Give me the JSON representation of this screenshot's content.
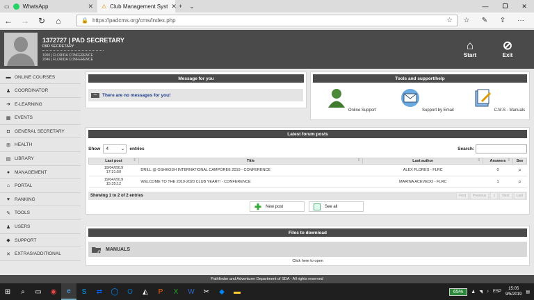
{
  "browser": {
    "tabs": [
      {
        "label": "WhatsApp"
      },
      {
        "label": "Club Management Syst"
      }
    ],
    "url": "https://padcms.org/cms/index.php"
  },
  "user": {
    "name": "1372727 | PAD SECRETARY",
    "role": "PAD SECRETARY",
    "conf1": "1000 | FLORIDA CONFERENCE",
    "conf2": "2046 | FLORIDA CONFERENCE"
  },
  "header_buttons": {
    "start": "Start",
    "exit": "Exit"
  },
  "sidebar": {
    "items": [
      {
        "label": "ONLINE COURSES",
        "icon": "monitor-icon"
      },
      {
        "label": "COORDINATOR",
        "icon": "user-tie-icon"
      },
      {
        "label": "E-LEARNING",
        "icon": "arrow-icon"
      },
      {
        "label": "EVENTS",
        "icon": "calendar-icon"
      },
      {
        "label": "GENERAL SECRETARY",
        "icon": "secretary-icon"
      },
      {
        "label": "HEALTH",
        "icon": "health-icon"
      },
      {
        "label": "LIBRARY",
        "icon": "library-icon"
      },
      {
        "label": "MANAGEMENT",
        "icon": "globe-icon"
      },
      {
        "label": "PORTAL",
        "icon": "home-icon"
      },
      {
        "label": "RANKING",
        "icon": "trophy-icon"
      },
      {
        "label": "TOOLS",
        "icon": "wrench-icon"
      },
      {
        "label": "USERS",
        "icon": "users-icon"
      },
      {
        "label": "SUPPORT",
        "icon": "handshake-icon"
      },
      {
        "label": "EXTRAS/ADDITIONAL",
        "icon": "extras-icon"
      }
    ]
  },
  "message_panel": {
    "title": "Message for you",
    "text": "There are no messages for you!"
  },
  "tools_panel": {
    "title": "Tools and support/help",
    "items": [
      {
        "label": "Online Support"
      },
      {
        "label": "Support by Email"
      },
      {
        "label": "C.M.S - Manuals"
      }
    ]
  },
  "forum": {
    "title": "Latest forum posts",
    "show_label": "Show",
    "entries_value": "4",
    "entries_label": "entries",
    "search_label": "Search:",
    "columns": [
      "Last post",
      "Title",
      "Last author",
      "Answers",
      "See"
    ],
    "rows": [
      {
        "date": "19/04/2019",
        "time": "17:31:50",
        "title": "DRILL @ OSHKOSH INTERNATIONAL CAMPOREE 2019 - CONFERENCE",
        "author": "ALEX FLORES - FLRC",
        "answers": "0"
      },
      {
        "date": "19/04/2019",
        "time": "15:35:12",
        "title": "WELCOME TO THE 2019-2020 CLUB YEAR!!! - CONFERENCE",
        "author": "MARINA ACEVEDO - FLRC",
        "answers": "1"
      }
    ],
    "info": "Showing 1 to 2 of 2 entries",
    "pager": [
      "First",
      "Previous",
      "1",
      "Next",
      "Last"
    ],
    "new_post": "New post",
    "see_all": "See all"
  },
  "files": {
    "title": "Files to download",
    "manuals": "MANUALS",
    "click": "Click here to open"
  },
  "footer": "Pathfinder and Adventurer Department of SDA - All rights reserved",
  "taskbar": {
    "battery": "65%",
    "lang": "ESP",
    "time": "15:05",
    "date": "9/5/2019"
  }
}
